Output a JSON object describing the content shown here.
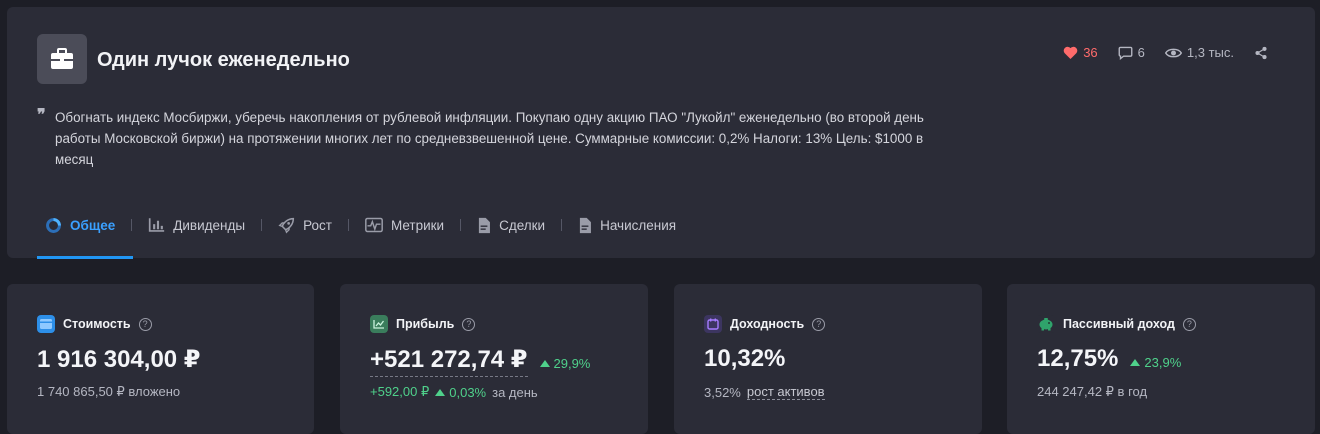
{
  "portfolio": {
    "title": "Один лучок еженедельно",
    "description": "Обогнать индекс Мосбиржи, уберечь накопления от рублевой инфляции. Покупаю одну акцию ПАО \"Лукойл\" еженедельно (во второй день работы Московской биржи) на протяжении многих лет по средневзвешенной цене. Суммарные комиссии: 0,2% Налоги: 13% Цель: $1000 в месяц"
  },
  "stats": {
    "likes": "36",
    "comments": "6",
    "views": "1,3 тыс."
  },
  "tabs": [
    {
      "label": "Общее",
      "icon": "donut-chart-icon",
      "active": true
    },
    {
      "label": "Дивиденды",
      "icon": "bar-chart-icon"
    },
    {
      "label": "Рост",
      "icon": "rocket-icon"
    },
    {
      "label": "Метрики",
      "icon": "pulse-icon"
    },
    {
      "label": "Сделки",
      "icon": "document-icon"
    },
    {
      "label": "Начисления",
      "icon": "document-icon"
    }
  ],
  "cards": {
    "value": {
      "label": "Стоимость",
      "amount": "1 916 304,00 ₽",
      "invested": "1 740 865,50 ₽ вложено"
    },
    "profit": {
      "label": "Прибыль",
      "amount": "+521 272,74 ₽",
      "percent": "29,9%",
      "daily_amount": "+592,00 ₽",
      "daily_percent": "0,03%",
      "daily_suffix": "за день"
    },
    "yield": {
      "label": "Доходность",
      "amount": "10,32%",
      "sub_value": "3,52%",
      "sub_label": "рост активов"
    },
    "passive": {
      "label": "Пассивный доход",
      "amount": "12,75%",
      "percent": "23,9%",
      "per_year": "244 247,42 ₽ в год"
    }
  },
  "colors": {
    "accent": "#2196f3",
    "positive": "#4fd18b",
    "likes": "#ff6b6b",
    "value_icon": "#2d8fe8",
    "profit_icon": "#3a7d5c",
    "yield_icon": "#8d5cf0",
    "passive_icon": "#2fa36b"
  }
}
